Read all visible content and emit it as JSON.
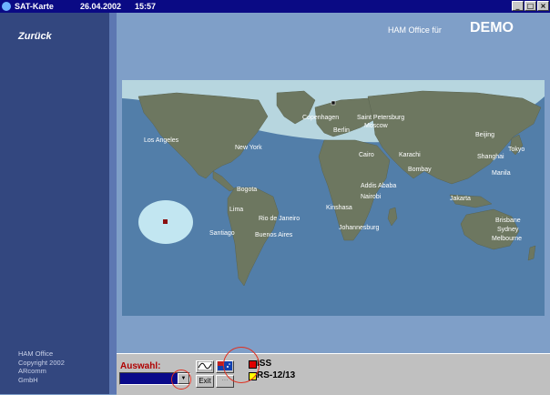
{
  "window": {
    "title": "SAT-Karte",
    "date": "26.04.2002",
    "time": "15:57",
    "controls": {
      "minimize": "_",
      "maximize": "□",
      "close": "×"
    }
  },
  "sidebar": {
    "back_label": "Zurück",
    "credits": [
      "HAM Office",
      "Copyright 2002",
      "ARcomm",
      "GmbH"
    ]
  },
  "header": {
    "label": "HAM Office für",
    "mode": "DEMO"
  },
  "map": {
    "cities": [
      {
        "name": "Copenhagen"
      },
      {
        "name": "Saint Petersburg"
      },
      {
        "name": "Berlin"
      },
      {
        "name": "Moscow"
      },
      {
        "name": "Los Angeles"
      },
      {
        "name": "New York"
      },
      {
        "name": "Bogota"
      },
      {
        "name": "Lima"
      },
      {
        "name": "Rio de Janeiro"
      },
      {
        "name": "Buenos Aires"
      },
      {
        "name": "Santiago"
      },
      {
        "name": "Cairo"
      },
      {
        "name": "Addis Ababa"
      },
      {
        "name": "Nairobi"
      },
      {
        "name": "Kinshasa"
      },
      {
        "name": "Johannesburg"
      },
      {
        "name": "Karachi"
      },
      {
        "name": "Bombay"
      },
      {
        "name": "Beijing"
      },
      {
        "name": "Shanghai"
      },
      {
        "name": "Tokyo"
      },
      {
        "name": "Manila"
      },
      {
        "name": "Jakarta"
      },
      {
        "name": "Brisbane"
      },
      {
        "name": "Sydney"
      },
      {
        "name": "Melbourne"
      }
    ],
    "colors": {
      "ocean": "#527ea9",
      "land": "#6d7760",
      "daylight": "#c2e0e4",
      "footprint": "#c8ecf4",
      "satellite": "#8a1010"
    }
  },
  "panel": {
    "auswahl_label": "Auswahl:",
    "exit_label": "Exit",
    "satellites": [
      {
        "name": "ISS",
        "color": "#e00000"
      },
      {
        "name": "RS-12/13",
        "color": "#ffff00"
      }
    ]
  }
}
